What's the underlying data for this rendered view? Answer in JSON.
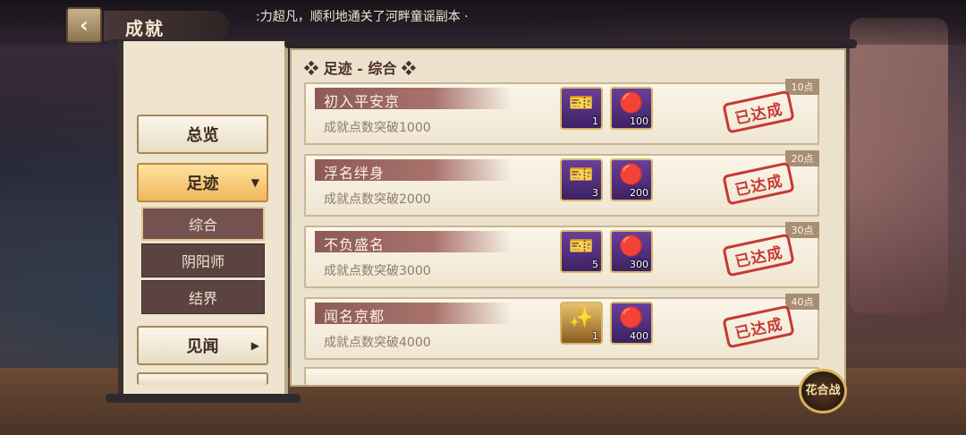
{
  "header": {
    "title": "成就",
    "marquee": ":力超凡，顺利地通关了河畔童谣副本 ·"
  },
  "sidebar": {
    "items": [
      {
        "label": "总览"
      },
      {
        "label": "足迹"
      },
      {
        "label": "见闻"
      }
    ],
    "sub_items": [
      {
        "label": "综合"
      },
      {
        "label": "阴阳师"
      },
      {
        "label": "结界"
      }
    ]
  },
  "section": {
    "title": "❖ 足迹 - 综合 ❖"
  },
  "achievements": [
    {
      "name": "初入平安京",
      "desc": "成就点数突破1000",
      "points": "10点",
      "status": "已达成",
      "rewards": [
        {
          "icon": "blue-ticket-icon",
          "qty": "1"
        },
        {
          "icon": "red-daruma-icon",
          "qty": "100"
        }
      ]
    },
    {
      "name": "浮名绊身",
      "desc": "成就点数突破2000",
      "points": "20点",
      "status": "已达成",
      "rewards": [
        {
          "icon": "blue-ticket-icon",
          "qty": "3"
        },
        {
          "icon": "red-daruma-icon",
          "qty": "200"
        }
      ]
    },
    {
      "name": "不负盛名",
      "desc": "成就点数突破3000",
      "points": "30点",
      "status": "已达成",
      "rewards": [
        {
          "icon": "blue-ticket-icon",
          "qty": "5"
        },
        {
          "icon": "red-daruma-icon",
          "qty": "300"
        }
      ]
    },
    {
      "name": "闻名京都",
      "desc": "成就点数突破4000",
      "points": "40点",
      "status": "已达成",
      "rewards": [
        {
          "icon": "gold-charm-icon",
          "qty": "1"
        },
        {
          "icon": "red-daruma-icon",
          "qty": "400"
        }
      ]
    }
  ],
  "badge": {
    "label": "花合战"
  },
  "colors": {
    "accent_gold": "#f0b75a",
    "stamp_red": "#c53a32",
    "name_bar": "#8d5a57"
  }
}
